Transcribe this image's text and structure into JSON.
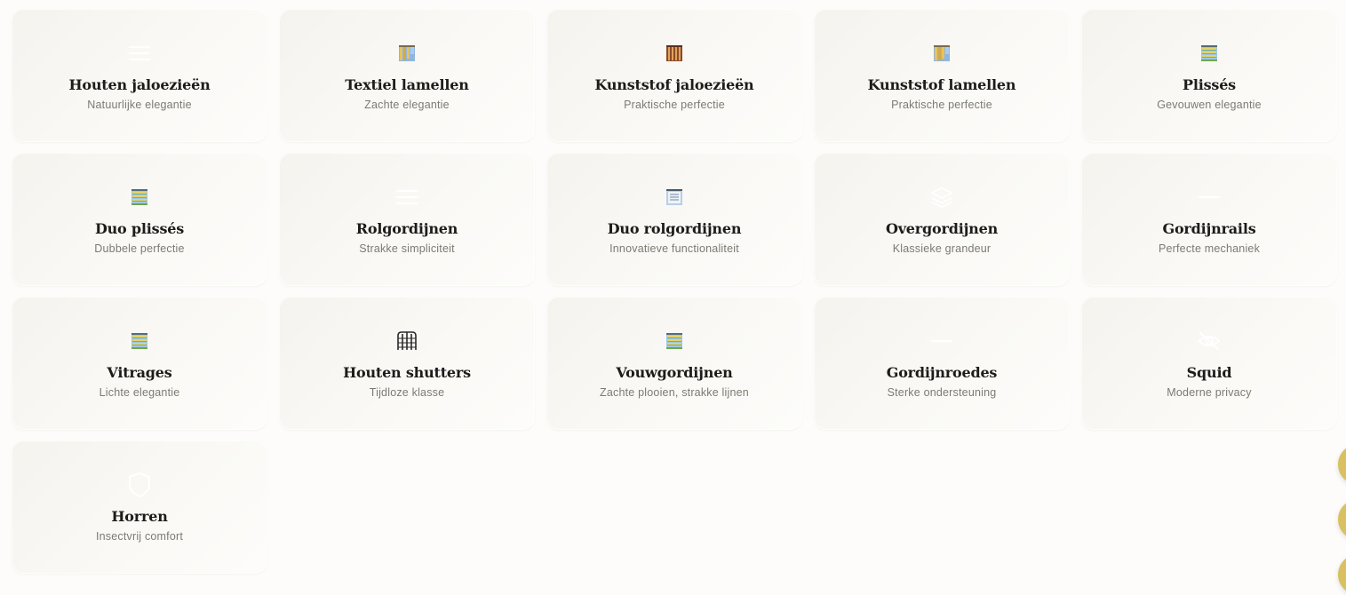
{
  "products": [
    {
      "title": "Houten jaloezieën",
      "subtitle": "Natuurlijke elegantie",
      "icon": "menu-lines-icon"
    },
    {
      "title": "Textiel lamellen",
      "subtitle": "Zachte elegantie",
      "icon": "vertical-blinds-icon"
    },
    {
      "title": "Kunststof jaloezieën",
      "subtitle": "Praktische perfectie",
      "icon": "wooden-blinds-icon"
    },
    {
      "title": "Kunststof lamellen",
      "subtitle": "Praktische perfectie",
      "icon": "vertical-blinds-icon"
    },
    {
      "title": "Plissés",
      "subtitle": "Gevouwen elegantie",
      "icon": "pleated-blind-icon"
    },
    {
      "title": "Duo plissés",
      "subtitle": "Dubbele perfectie",
      "icon": "pleated-blind-icon"
    },
    {
      "title": "Rolgordijnen",
      "subtitle": "Strakke simpliciteit",
      "icon": "menu-lines-icon"
    },
    {
      "title": "Duo rolgordijnen",
      "subtitle": "Innovatieve functionaliteit",
      "icon": "roller-blind-icon"
    },
    {
      "title": "Overgordijnen",
      "subtitle": "Klassieke grandeur",
      "icon": "layers-icon"
    },
    {
      "title": "Gordijnrails",
      "subtitle": "Perfecte mechaniek",
      "icon": "minus-icon"
    },
    {
      "title": "Vitrages",
      "subtitle": "Lichte elegantie",
      "icon": "pleated-blind-icon"
    },
    {
      "title": "Houten shutters",
      "subtitle": "Tijdloze klasse",
      "icon": "shutters-icon"
    },
    {
      "title": "Vouwgordijnen",
      "subtitle": "Zachte plooien, strakke lijnen",
      "icon": "pleated-blind-icon"
    },
    {
      "title": "Gordijnroedes",
      "subtitle": "Sterke ondersteuning",
      "icon": "minus-icon"
    },
    {
      "title": "Squid",
      "subtitle": "Moderne privacy",
      "icon": "eye-off-icon"
    },
    {
      "title": "Horren",
      "subtitle": "Insectvrij comfort",
      "icon": "shield-icon"
    }
  ],
  "colors": {
    "accent": "#d9c061",
    "title": "#1d1c1a",
    "subtitle": "#7d7a73",
    "card_bg": "#f7f5f0",
    "page_bg": "#fdfcfa"
  },
  "floating_buttons": [
    "floating-action-button",
    "floating-action-button",
    "floating-action-button"
  ]
}
